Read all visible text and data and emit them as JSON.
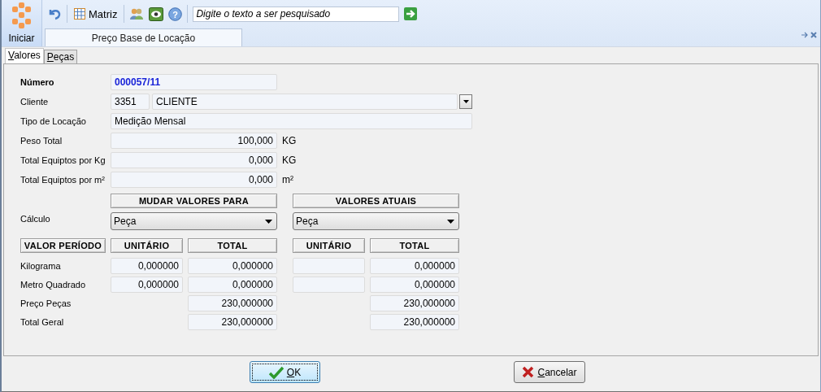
{
  "toolbar": {
    "start_label": "Iniciar",
    "matrix_label": "Matriz",
    "help_glyph": "?",
    "search": {
      "placeholder": "Digite o texto a ser pesquisado"
    }
  },
  "document_tab": {
    "title": "Preço Base de Locação",
    "selected": true
  },
  "tabs": [
    {
      "label": "Valores",
      "selected": true
    },
    {
      "label": "Peças",
      "selected": false
    }
  ],
  "form": {
    "numero": {
      "label": "Número",
      "value": "000057/11"
    },
    "cliente": {
      "label": "Cliente",
      "code": "3351",
      "name": "CLIENTE"
    },
    "tipo": {
      "label": "Tipo de Locação",
      "value": "Medição Mensal"
    },
    "measures": [
      {
        "label": "Peso Total",
        "value": "100,000",
        "unit": "KG"
      },
      {
        "label": "Total Equiptos por Kg",
        "value": "0,000",
        "unit": "KG"
      },
      {
        "label": "Total Equiptos por m²",
        "value": "0,000",
        "unit": "m²"
      }
    ]
  },
  "calc": {
    "label": "Cálculo",
    "new_header": "MUDAR VALORES PARA",
    "current_header": "VALORES ATUAIS",
    "new_value": "Peça",
    "current_value": "Peça"
  },
  "values": {
    "headers": [
      "VALOR PERÍODO",
      "UNITÁRIO",
      "TOTAL",
      "UNITÁRIO",
      "TOTAL"
    ],
    "rows": [
      {
        "kind": "unit",
        "label": "Kilograma",
        "new_unit": "0,000000",
        "new_total": "0,000000",
        "current_total": "0,000000"
      },
      {
        "kind": "unit",
        "label": "Metro Quadrado",
        "new_unit": "0,000000",
        "new_total": "0,000000",
        "current_total": "0,000000"
      },
      {
        "kind": "total",
        "label": "Preço Peças",
        "new_total": "230,000000",
        "current_total": "230,000000"
      },
      {
        "kind": "total",
        "label": "Total Geral",
        "new_total": "230,000000",
        "current_total": "230,000000"
      }
    ]
  },
  "buttons": [
    {
      "kind": "ok",
      "label": "OK"
    },
    {
      "kind": "cancel",
      "label": "Cancelar"
    }
  ]
}
